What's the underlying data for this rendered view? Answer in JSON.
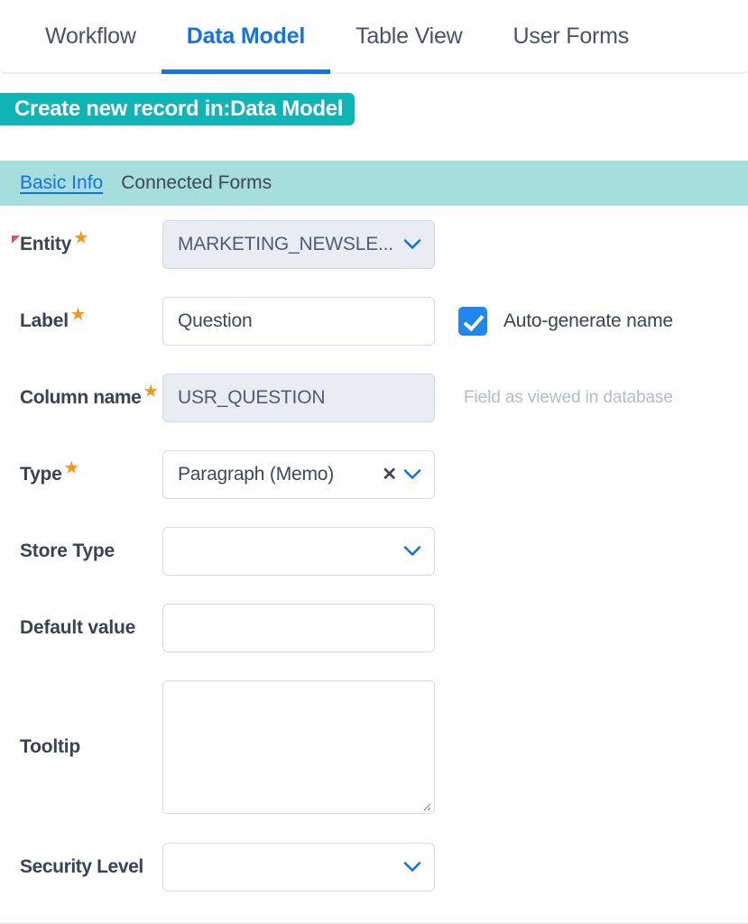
{
  "tabs": [
    {
      "label": "Workflow",
      "active": false
    },
    {
      "label": "Data Model",
      "active": true
    },
    {
      "label": "Table View",
      "active": false
    },
    {
      "label": "User Forms",
      "active": false
    }
  ],
  "banner": {
    "text": "Create new record in:Data Model",
    "background": "#0fb5b5",
    "text_color": "#ffffff"
  },
  "subtabs": [
    {
      "label": "Basic Info",
      "active": true
    },
    {
      "label": "Connected Forms",
      "active": false
    }
  ],
  "subtab_bar": {
    "background": "#a5dedd"
  },
  "colors": {
    "accent_blue": "#1373e6",
    "teal": "#0fb5b5",
    "teal_light": "#a5dedd",
    "required_star": "#f7941e",
    "flag_red": "#ef4b5c",
    "checkbox_blue": "#1f87f0",
    "label_text": "#3a4254",
    "helper_text": "#b6bcc6",
    "field_border": "#d6dce8",
    "field_disabled_bg": "#e9edf3"
  },
  "fields": {
    "entity": {
      "label": "Entity",
      "required_marker": "star",
      "flag_marker": "red-flag",
      "value": "MARKETING_NEWSLE...",
      "control": "select",
      "disabled": true
    },
    "label_field": {
      "label": "Label",
      "required_marker": "star",
      "value": "Question",
      "placeholder": "",
      "control": "text",
      "checkbox": {
        "label": "Auto-generate name",
        "checked": true
      }
    },
    "column_name": {
      "label": "Column name",
      "required_marker": "star",
      "value": "USR_QUESTION",
      "control": "text",
      "disabled": true,
      "helper": "Field as viewed in database"
    },
    "type": {
      "label": "Type",
      "required_marker": "star",
      "value": "Paragraph (Memo)",
      "control": "select",
      "clearable": true
    },
    "store_type": {
      "label": "Store Type",
      "value": "",
      "control": "select"
    },
    "default_value": {
      "label": "Default value",
      "value": "",
      "placeholder": "",
      "control": "text"
    },
    "tooltip": {
      "label": "Tooltip",
      "value": "",
      "placeholder": "",
      "control": "textarea"
    },
    "security_level": {
      "label": "Security Level",
      "value": "",
      "control": "select"
    }
  },
  "icons": {
    "chevron_down": "chevron-down-icon",
    "clear": "close-icon",
    "required_star": "star-icon",
    "flag": "flag-icon",
    "resize_handle": "resize-handle-icon"
  }
}
